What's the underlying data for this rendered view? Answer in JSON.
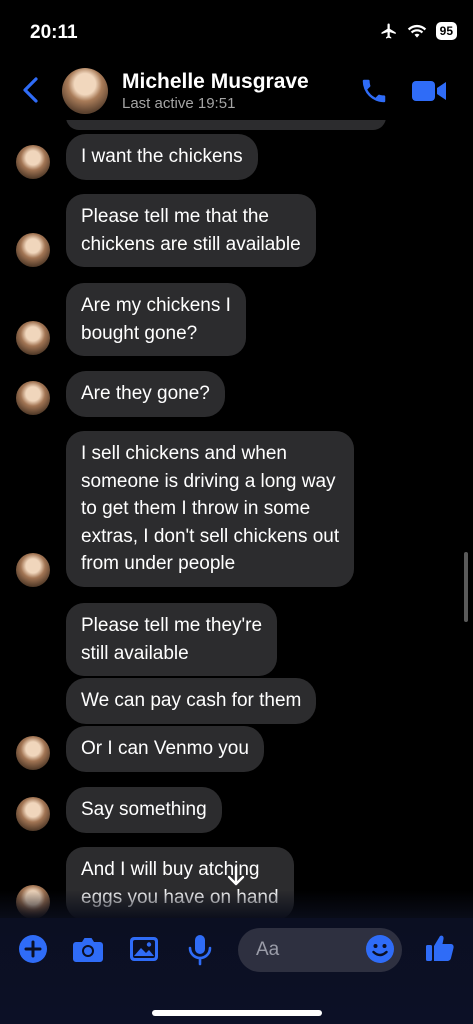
{
  "status": {
    "time": "20:11",
    "battery": "95"
  },
  "header": {
    "name": "Michelle Musgrave",
    "last_active": "Last active 19:51"
  },
  "messages": [
    {
      "lines": [
        "I want the chickens"
      ]
    },
    {
      "lines": [
        "Please tell me that the",
        "chickens are still available"
      ]
    },
    {
      "lines": [
        "Are my chickens I",
        "bought gone?"
      ]
    },
    {
      "lines": [
        "Are they gone?"
      ]
    },
    {
      "lines": [
        "I sell chickens and when",
        "someone is driving a long way",
        "to get them I throw in some",
        "extras, I don't sell chickens out",
        "from under people"
      ]
    },
    {
      "lines": [
        "Please tell me they're",
        "still available"
      ]
    },
    {
      "lines": [
        "We can pay cash for them"
      ]
    },
    {
      "lines": [
        "Or I can Venmo you"
      ]
    },
    {
      "lines": [
        "Say something"
      ]
    },
    {
      "lines": [
        "And I will buy    atching",
        "eggs you have on hand"
      ]
    }
  ],
  "composer": {
    "placeholder": "Aa"
  },
  "colors": {
    "accent": "#2f6cf7",
    "bubble": "#2c2c2e",
    "background": "#000000"
  },
  "icons": [
    "airplane-icon",
    "wifi-icon",
    "back-chevron-icon",
    "phone-icon",
    "video-icon",
    "plus-icon",
    "camera-icon",
    "image-icon",
    "microphone-icon",
    "emoji-icon",
    "thumbs-up-icon",
    "arrow-down-icon"
  ]
}
